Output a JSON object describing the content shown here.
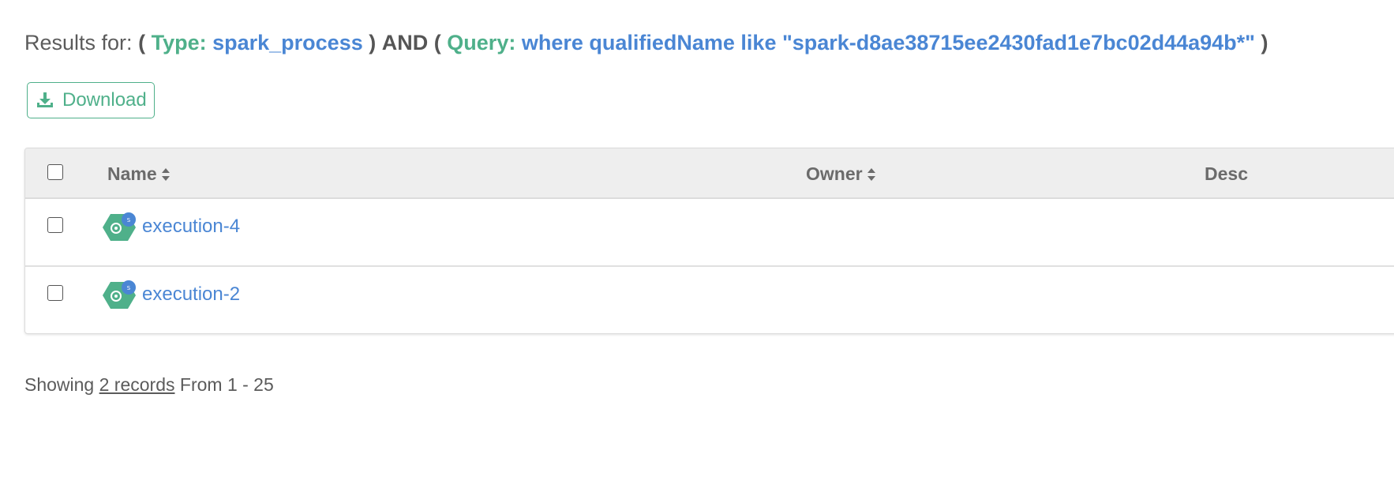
{
  "results": {
    "prefix": "Results for:",
    "open_paren": "(",
    "close_paren": ")",
    "and_op": "AND",
    "type_key": "Type:",
    "type_value": "spark_process",
    "query_key": "Query:",
    "query_value": "where qualifiedName like \"spark-d8ae38715ee2430fad1e7bc02d44a94b*\""
  },
  "toolbar": {
    "download_label": "Download"
  },
  "table": {
    "columns": [
      {
        "label": "Name",
        "sortable": true
      },
      {
        "label": "Owner",
        "sortable": true
      },
      {
        "label": "Desc",
        "sortable": false
      }
    ],
    "rows": [
      {
        "name": "execution-4",
        "owner": "",
        "icon": "spark-process-icon"
      },
      {
        "name": "execution-2",
        "owner": "",
        "icon": "spark-process-icon"
      }
    ]
  },
  "footer": {
    "showing": "Showing",
    "records_link": "2 records",
    "range": "From 1 - 25"
  },
  "colors": {
    "accent_green": "#4fb08a",
    "link_blue": "#4a86d4",
    "header_bg": "#eeeeee"
  }
}
